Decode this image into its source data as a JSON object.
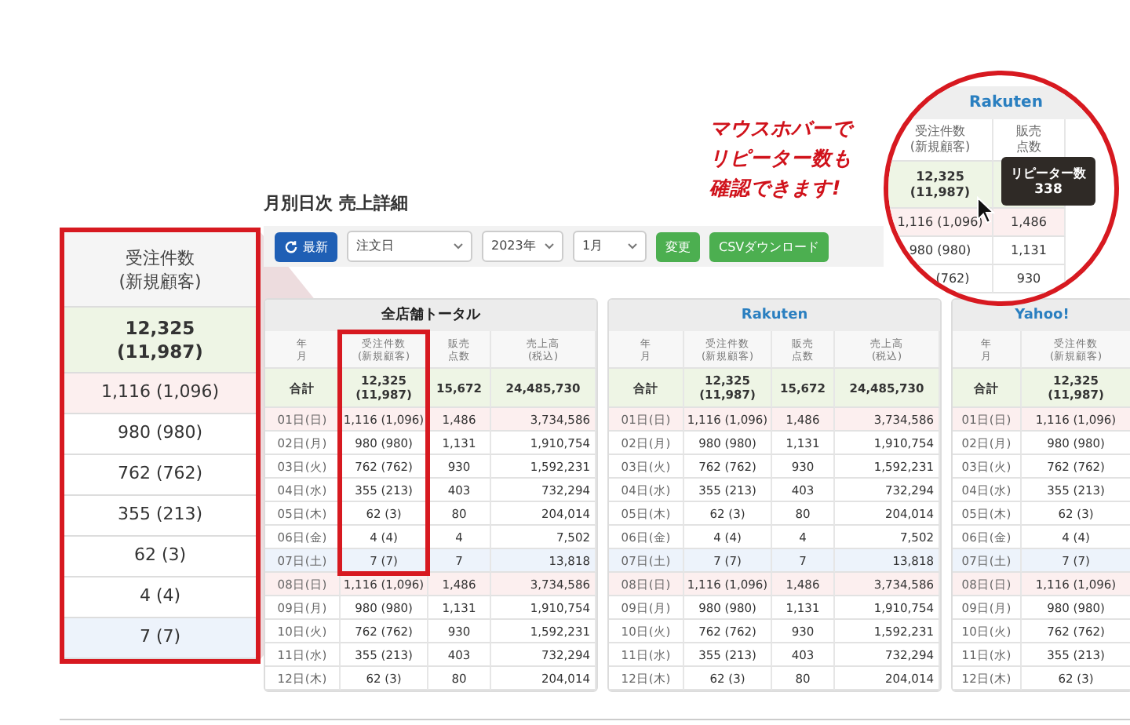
{
  "page_title": "月別日次 売上詳細",
  "toolbar": {
    "refresh_button": "最新",
    "date_type_select": "注文日",
    "year_select": "2023年",
    "month_select": "1月",
    "apply_button": "変更",
    "csv_button": "CSVダウンロード"
  },
  "panels": [
    {
      "title": "全店舗トータル",
      "color": "#222222",
      "columns": [
        "年月",
        "受注件数\n(新規顧客)",
        "販売点数",
        "売上高\n(税込)"
      ],
      "total": [
        "合計",
        "12,325\n(11,987)",
        "15,672",
        "24,485,730"
      ],
      "rows": [
        {
          "kind": "sunday",
          "cells": [
            "01日(日)",
            "1,116 (1,096)",
            "1,486",
            "3,734,586"
          ]
        },
        {
          "kind": "weekday",
          "cells": [
            "02日(月)",
            "980 (980)",
            "1,131",
            "1,910,754"
          ]
        },
        {
          "kind": "weekday",
          "cells": [
            "03日(火)",
            "762 (762)",
            "930",
            "1,592,231"
          ]
        },
        {
          "kind": "weekday",
          "cells": [
            "04日(水)",
            "355 (213)",
            "403",
            "732,294"
          ]
        },
        {
          "kind": "weekday",
          "cells": [
            "05日(木)",
            "62 (3)",
            "80",
            "204,014"
          ]
        },
        {
          "kind": "weekday",
          "cells": [
            "06日(金)",
            "4 (4)",
            "4",
            "7,502"
          ]
        },
        {
          "kind": "saturday",
          "cells": [
            "07日(土)",
            "7 (7)",
            "7",
            "13,818"
          ]
        },
        {
          "kind": "sunday",
          "cells": [
            "08日(日)",
            "1,116 (1,096)",
            "1,486",
            "3,734,586"
          ]
        },
        {
          "kind": "weekday",
          "cells": [
            "09日(月)",
            "980 (980)",
            "1,131",
            "1,910,754"
          ]
        },
        {
          "kind": "weekday",
          "cells": [
            "10日(火)",
            "762 (762)",
            "930",
            "1,592,231"
          ]
        },
        {
          "kind": "weekday",
          "cells": [
            "11日(水)",
            "355 (213)",
            "403",
            "732,294"
          ]
        },
        {
          "kind": "weekday",
          "cells": [
            "12日(木)",
            "62 (3)",
            "80",
            "204,014"
          ]
        }
      ]
    },
    {
      "title": "Rakuten",
      "color": "#2a7fc0",
      "columns": [
        "年月",
        "受注件数\n(新規顧客)",
        "販売点数",
        "売上高\n(税込)"
      ],
      "total": [
        "合計",
        "12,325\n(11,987)",
        "15,672",
        "24,485,730"
      ],
      "rows": [
        {
          "kind": "sunday",
          "cells": [
            "01日(日)",
            "1,116 (1,096)",
            "1,486",
            "3,734,586"
          ]
        },
        {
          "kind": "weekday",
          "cells": [
            "02日(月)",
            "980 (980)",
            "1,131",
            "1,910,754"
          ]
        },
        {
          "kind": "weekday",
          "cells": [
            "03日(火)",
            "762 (762)",
            "930",
            "1,592,231"
          ]
        },
        {
          "kind": "weekday",
          "cells": [
            "04日(水)",
            "355 (213)",
            "403",
            "732,294"
          ]
        },
        {
          "kind": "weekday",
          "cells": [
            "05日(木)",
            "62 (3)",
            "80",
            "204,014"
          ]
        },
        {
          "kind": "weekday",
          "cells": [
            "06日(金)",
            "4 (4)",
            "4",
            "7,502"
          ]
        },
        {
          "kind": "saturday",
          "cells": [
            "07日(土)",
            "7 (7)",
            "7",
            "13,818"
          ]
        },
        {
          "kind": "sunday",
          "cells": [
            "08日(日)",
            "1,116 (1,096)",
            "1,486",
            "3,734,586"
          ]
        },
        {
          "kind": "weekday",
          "cells": [
            "09日(月)",
            "980 (980)",
            "1,131",
            "1,910,754"
          ]
        },
        {
          "kind": "weekday",
          "cells": [
            "10日(火)",
            "762 (762)",
            "930",
            "1,592,231"
          ]
        },
        {
          "kind": "weekday",
          "cells": [
            "11日(水)",
            "355 (213)",
            "403",
            "732,294"
          ]
        },
        {
          "kind": "weekday",
          "cells": [
            "12日(木)",
            "62 (3)",
            "80",
            "204,014"
          ]
        }
      ]
    },
    {
      "title": "Yahoo!",
      "color": "#2a7fc0",
      "columns": [
        "年月",
        "受注件数\n(新規顧客)"
      ],
      "total": [
        "合計",
        "12,325\n(11,987)"
      ],
      "rows": [
        {
          "kind": "sunday",
          "cells": [
            "01日(日)",
            "1,116 (1,096)"
          ]
        },
        {
          "kind": "weekday",
          "cells": [
            "02日(月)",
            "980 (980)"
          ]
        },
        {
          "kind": "weekday",
          "cells": [
            "03日(火)",
            "762 (762)"
          ]
        },
        {
          "kind": "weekday",
          "cells": [
            "04日(水)",
            "355 (213)"
          ]
        },
        {
          "kind": "weekday",
          "cells": [
            "05日(木)",
            "62 (3)"
          ]
        },
        {
          "kind": "weekday",
          "cells": [
            "06日(金)",
            "4 (4)"
          ]
        },
        {
          "kind": "saturday",
          "cells": [
            "07日(土)",
            "7 (7)"
          ]
        },
        {
          "kind": "sunday",
          "cells": [
            "08日(日)",
            "1,116 (1,096)"
          ]
        },
        {
          "kind": "weekday",
          "cells": [
            "09日(月)",
            "980 (980)"
          ]
        },
        {
          "kind": "weekday",
          "cells": [
            "10日(火)",
            "762 (762)"
          ]
        },
        {
          "kind": "weekday",
          "cells": [
            "11日(水)",
            "355 (213)"
          ]
        },
        {
          "kind": "weekday",
          "cells": [
            "12日(木)",
            "62 (3)"
          ]
        }
      ]
    }
  ],
  "magnified_column": {
    "header": "受注件数\n(新規顧客)",
    "total": "12,325\n(11,987)",
    "rows": [
      {
        "kind": "sunday",
        "value": "1,116 (1,096)"
      },
      {
        "kind": "weekday",
        "value": "980 (980)"
      },
      {
        "kind": "weekday",
        "value": "762 (762)"
      },
      {
        "kind": "weekday",
        "value": "355 (213)"
      },
      {
        "kind": "weekday",
        "value": "62 (3)"
      },
      {
        "kind": "weekday",
        "value": "4 (4)"
      },
      {
        "kind": "saturday",
        "value": "7 (7)"
      }
    ]
  },
  "annotation": "マウスホバーでリピーター数も確認できます!",
  "hover_callout": {
    "store": "Rakuten",
    "columns": [
      "受注件数\n(新規顧客)",
      "販売点数"
    ],
    "total": "12,325\n(11,987)",
    "tooltip": {
      "label": "リピーター数",
      "value": "338"
    },
    "rows": [
      {
        "kind": "sunday",
        "cells": [
          "1,116 (1,096)",
          "1,486"
        ]
      },
      {
        "kind": "weekday",
        "cells": [
          "980 (980)",
          "1,131"
        ]
      },
      {
        "kind": "weekday",
        "cells": [
          "(762)",
          "930"
        ]
      }
    ]
  }
}
